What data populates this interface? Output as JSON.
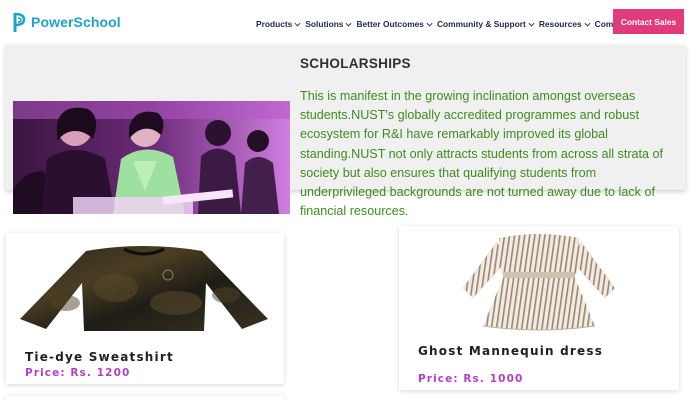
{
  "brand": {
    "name": "PowerSchool",
    "color": "#1fa3c9",
    "logo_icon": "powerschool-logo-icon"
  },
  "nav": {
    "items": [
      {
        "label": "Products"
      },
      {
        "label": "Solutions"
      },
      {
        "label": "Better Outcomes"
      },
      {
        "label": "Community & Support"
      },
      {
        "label": "Resources"
      },
      {
        "label": "Company"
      }
    ],
    "chevron_icon": "chevron-down-icon",
    "cta_label": "Contact Sales",
    "cta_color": "#e23b7b"
  },
  "scholarships": {
    "title": "SCHOLARSHIPS",
    "body": "This is manifest in the growing inclination amongst overseas students.NUST's globally accredited programmes and robust ecosystem for R&I have remarkably improved its global standing.NUST not only attracts students from across all strata of society but also ensures that qualifying students from underprivileged backgrounds are not turned away due to lack of financial resources.",
    "text_color": "#3f8c1e"
  },
  "products": [
    {
      "name": "Tie-dye Sweatshirt",
      "price": "Price: Rs. 1200"
    },
    {
      "name": "Ghost Mannequin dress",
      "price": "Price: Rs. 1000"
    }
  ],
  "price_color": "#b23fc7"
}
